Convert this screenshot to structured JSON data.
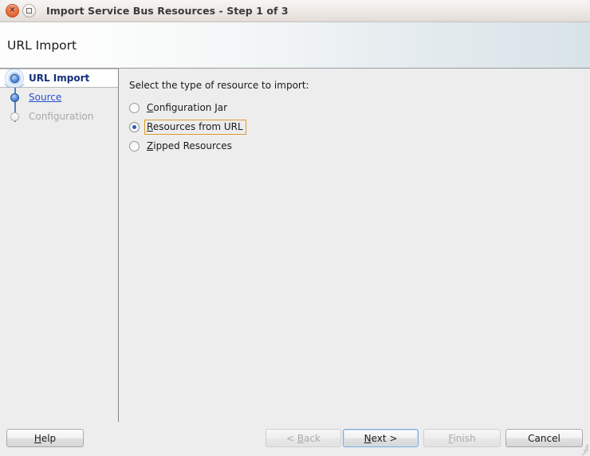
{
  "window": {
    "title": "Import Service Bus Resources - Step 1 of 3",
    "close_icon": "close-icon",
    "maximize_icon": "maximize-icon"
  },
  "header": {
    "title": "URL Import"
  },
  "sidebar": {
    "steps": [
      {
        "label": "URL Import",
        "state": "current"
      },
      {
        "label": "Source",
        "state": "link"
      },
      {
        "label": "Configuration",
        "state": "disabled"
      }
    ]
  },
  "main": {
    "instruction": "Select the type of resource to import:",
    "options": [
      {
        "mnemonic": "C",
        "rest": "onfiguration Jar",
        "selected": false,
        "focused": false
      },
      {
        "mnemonic": "R",
        "rest": "esources from URL",
        "selected": true,
        "focused": true
      },
      {
        "mnemonic": "Z",
        "rest": "ipped Resources",
        "selected": false,
        "focused": false
      }
    ]
  },
  "footer": {
    "help": {
      "mnemonic": "H",
      "rest": "elp",
      "enabled": true
    },
    "back": {
      "prefix": "< ",
      "mnemonic": "B",
      "rest": "ack",
      "enabled": false
    },
    "next": {
      "mnemonic": "N",
      "rest": "ext >",
      "enabled": true,
      "is_default": true
    },
    "finish": {
      "mnemonic": "F",
      "rest": "inish",
      "enabled": false
    },
    "cancel": {
      "label": "Cancel",
      "enabled": true
    }
  },
  "colors": {
    "accent_blue": "#2a4fd0",
    "focus_orange": "#d99b2a",
    "default_button_border": "#7aa9dd",
    "window_bg": "#ededed",
    "close_button": "#e8703f"
  }
}
